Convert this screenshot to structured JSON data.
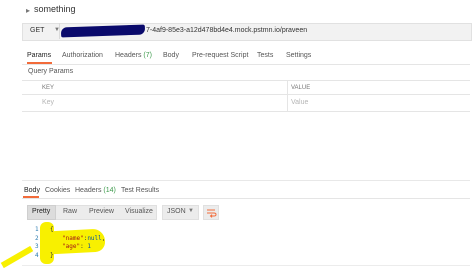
{
  "request": {
    "name": "something",
    "method": "GET",
    "url_visible": "7-4af9-85e3-a12d478bd4e4.mock.pstmn.io/praveen",
    "tabs": [
      {
        "label": "Params",
        "count": ""
      },
      {
        "label": "Authorization",
        "count": ""
      },
      {
        "label": "Headers",
        "count": "(7)"
      },
      {
        "label": "Body",
        "count": ""
      },
      {
        "label": "Pre-request Script",
        "count": ""
      },
      {
        "label": "Tests",
        "count": ""
      },
      {
        "label": "Settings",
        "count": ""
      }
    ],
    "active_tab": "Params",
    "query_params_label": "Query Params",
    "table": {
      "key_header": "KEY",
      "value_header": "VALUE",
      "key_placeholder": "Key",
      "value_placeholder": "Value"
    }
  },
  "response": {
    "tabs": [
      {
        "label": "Body",
        "count": ""
      },
      {
        "label": "Cookies",
        "count": ""
      },
      {
        "label": "Headers",
        "count": "(14)"
      },
      {
        "label": "Test Results",
        "count": ""
      }
    ],
    "active_tab": "Body",
    "format_buttons": [
      "Pretty",
      "Raw",
      "Preview",
      "Visualize"
    ],
    "active_format": "Pretty",
    "language": "JSON",
    "line_numbers": [
      "1",
      "2",
      "3",
      "4"
    ],
    "code": {
      "open": "{",
      "line2_key": "\"name\"",
      "line2_colon": ":",
      "line2_value": "null",
      "line2_comma": ",",
      "line3_key": "\"age\"",
      "line3_colon": ":",
      "line3_value": "1",
      "close": "}"
    }
  },
  "colors": {
    "accent": "#f26b3a",
    "redaction": "#0a0a6c",
    "highlight": "#f8f000"
  }
}
